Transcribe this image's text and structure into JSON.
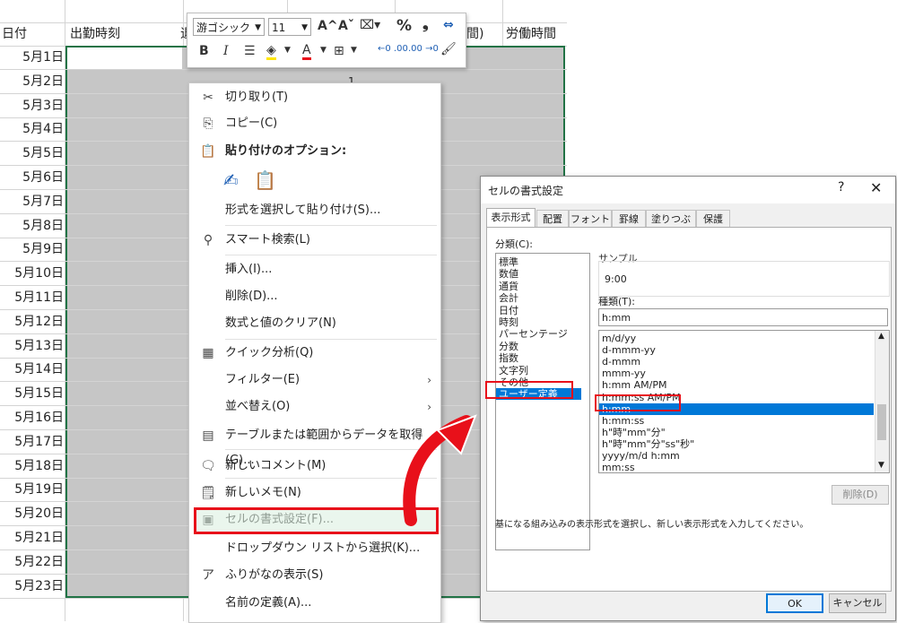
{
  "sheet": {
    "headers": {
      "date": "日付",
      "start": "出勤時刻",
      "partial": "退",
      "partial2": "間)",
      "work": "労働時間"
    },
    "dates": [
      "5月1日",
      "5月2日",
      "5月3日",
      "5月4日",
      "5月5日",
      "5月6日",
      "5月7日",
      "5月8日",
      "5月9日",
      "5月10日",
      "5月11日",
      "5月12日",
      "5月13日",
      "5月14日",
      "5月15日",
      "5月16日",
      "5月17日",
      "5月18日",
      "5月19日",
      "5月20日",
      "5月21日",
      "5月22日",
      "5月23日"
    ],
    "cell_value": "1"
  },
  "mini_toolbar": {
    "font_name": "游ゴシック",
    "font_size": "11",
    "grow": "A^",
    "shrink": "Aˇ",
    "percent": "%",
    "comma": "❟",
    "bold": "B",
    "italic": "I",
    "font_color_letter": "A"
  },
  "context_menu": {
    "items": [
      {
        "icon": "scissors-icon",
        "glyph": "✂",
        "label": "切り取り(T)"
      },
      {
        "icon": "copy-icon",
        "glyph": "⎘",
        "label": "コピー(C)"
      },
      {
        "icon": "paste-icon",
        "glyph": "📋",
        "label": "貼り付けのオプション:"
      },
      {
        "icon": "none",
        "glyph": "",
        "label": "形式を選択して貼り付け(S)..."
      },
      {
        "icon": "smart-search-icon",
        "glyph": "⚲",
        "label": "スマート検索(L)"
      },
      {
        "icon": "none",
        "glyph": "",
        "label": "挿入(I)..."
      },
      {
        "icon": "none",
        "glyph": "",
        "label": "削除(D)..."
      },
      {
        "icon": "none",
        "glyph": "",
        "label": "数式と値のクリア(N)"
      },
      {
        "icon": "quick-analysis-icon",
        "glyph": "▦",
        "label": "クイック分析(Q)"
      },
      {
        "icon": "none",
        "glyph": "",
        "label": "フィルター(E)",
        "submenu": "›"
      },
      {
        "icon": "none",
        "glyph": "",
        "label": "並べ替え(O)",
        "submenu": "›"
      },
      {
        "icon": "table-icon",
        "glyph": "▤",
        "label": "テーブルまたは範囲からデータを取得(G)..."
      },
      {
        "icon": "new-comment-icon",
        "glyph": "🗨",
        "label": "新しいコメント(M)"
      },
      {
        "icon": "new-note-icon",
        "glyph": "🗒",
        "label": "新しいメモ(N)"
      },
      {
        "icon": "format-cells-icon",
        "glyph": "▣",
        "label": "セルの書式設定(F)..."
      },
      {
        "icon": "none",
        "glyph": "",
        "label": "ドロップダウン リストから選択(K)..."
      },
      {
        "icon": "furigana-icon",
        "glyph": "ア",
        "label": "ふりがなの表示(S)"
      },
      {
        "icon": "none",
        "glyph": "",
        "label": "名前の定義(A)..."
      }
    ]
  },
  "dialog": {
    "title": "セルの書式設定",
    "help": "?",
    "close": "✕",
    "tabs": [
      "表示形式",
      "配置",
      "フォント",
      "罫線",
      "塗りつぶし",
      "保護"
    ],
    "category_label": "分類(C):",
    "categories": [
      "標準",
      "数値",
      "通貨",
      "会計",
      "日付",
      "時刻",
      "パーセンテージ",
      "分数",
      "指数",
      "文字列",
      "その他",
      "ユーザー定義"
    ],
    "sample_label": "サンプル",
    "sample_value": "9:00",
    "type_label": "種類(T):",
    "type_value": "h:mm",
    "formats": [
      "m/d/yy",
      "d-mmm-yy",
      "d-mmm",
      "mmm-yy",
      "h:mm AM/PM",
      "h:mm:ss AM/PM",
      "h:mm",
      "h:mm:ss",
      "h\"時\"mm\"分\"",
      "h\"時\"mm\"分\"ss\"秒\"",
      "yyyy/m/d h:mm",
      "mm:ss"
    ],
    "delete_button": "削除(D)",
    "note": "基になる組み込みの表示形式を選択し、新しい表示形式を入力してください。",
    "ok": "OK",
    "cancel": "キャンセル"
  },
  "colors": {
    "accent": "#0078d7",
    "highlight_red": "#e8101a",
    "selection_border": "#217346"
  }
}
